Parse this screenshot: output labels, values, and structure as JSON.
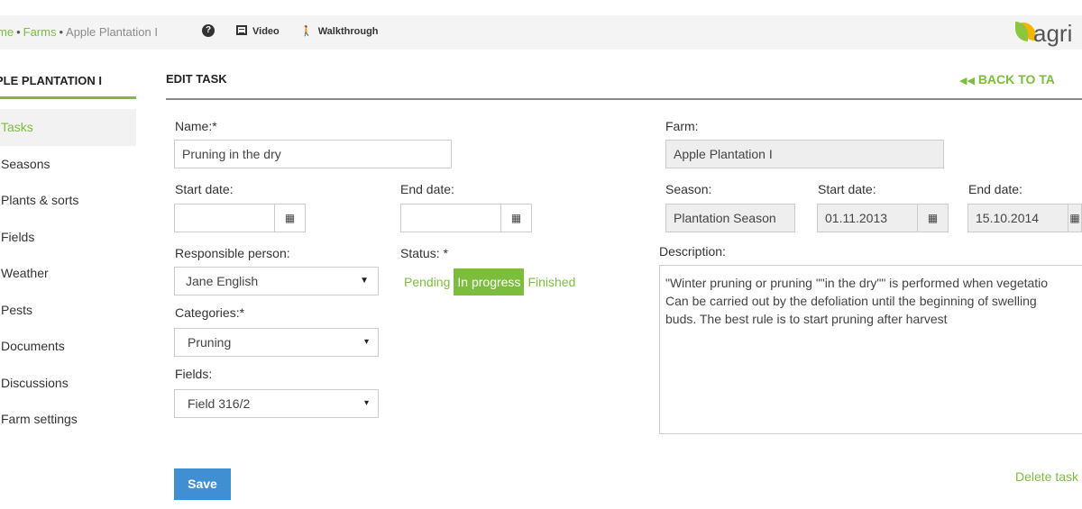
{
  "breadcrumb": {
    "home": "me",
    "farms": "Farms",
    "current": "Apple Plantation I",
    "separator": "•"
  },
  "toolbar": {
    "help_icon": "question-circle-icon",
    "video_label": "Video",
    "walkthrough_label": "Walkthrough"
  },
  "logo": {
    "text": "agri"
  },
  "sidebar": {
    "title": "PLE PLANTATION I",
    "items": [
      {
        "label": "Tasks",
        "active": true
      },
      {
        "label": "Seasons"
      },
      {
        "label": "Plants & sorts"
      },
      {
        "label": "Fields"
      },
      {
        "label": "Weather"
      },
      {
        "label": "Pests"
      },
      {
        "label": "Documents"
      },
      {
        "label": "Discussions"
      },
      {
        "label": "Farm settings"
      }
    ]
  },
  "main": {
    "title": "EDIT TASK",
    "back_label": "BACK TO TA"
  },
  "form": {
    "name_label": "Name:*",
    "name_value": "Pruning in the dry",
    "start_date_label": "Start date:",
    "start_date_value": "",
    "end_date_label": "End date:",
    "end_date_value": "",
    "responsible_label": "Responsible person:",
    "responsible_value": "Jane English",
    "status_label": "Status: *",
    "status_options": [
      "Pending",
      "In progress",
      "Finished"
    ],
    "status_selected": "In progress",
    "categories_label": "Categories:*",
    "categories_value": "Pruning",
    "fields_label": "Fields:",
    "fields_value": "Field 316/2"
  },
  "right": {
    "farm_label": "Farm:",
    "farm_value": "Apple Plantation I",
    "season_label": "Season:",
    "season_value": "Plantation Season",
    "start_date_label": "Start date:",
    "start_date_value": "01.11.2013",
    "end_date_label": "End date:",
    "end_date_value": "15.10.2014",
    "description_label": "Description:",
    "description_value": "\"Winter pruning or pruning \"\"in the dry\"\" is performed when vegetatio\nCan be carried out by the defoliation until the beginning of swelling\nbuds. The best rule is to start pruning after harvest"
  },
  "actions": {
    "save_label": "Save",
    "delete_label": "Delete task"
  },
  "colors": {
    "accent_green": "#7cbd3e",
    "save_blue": "#3f8fd2"
  }
}
